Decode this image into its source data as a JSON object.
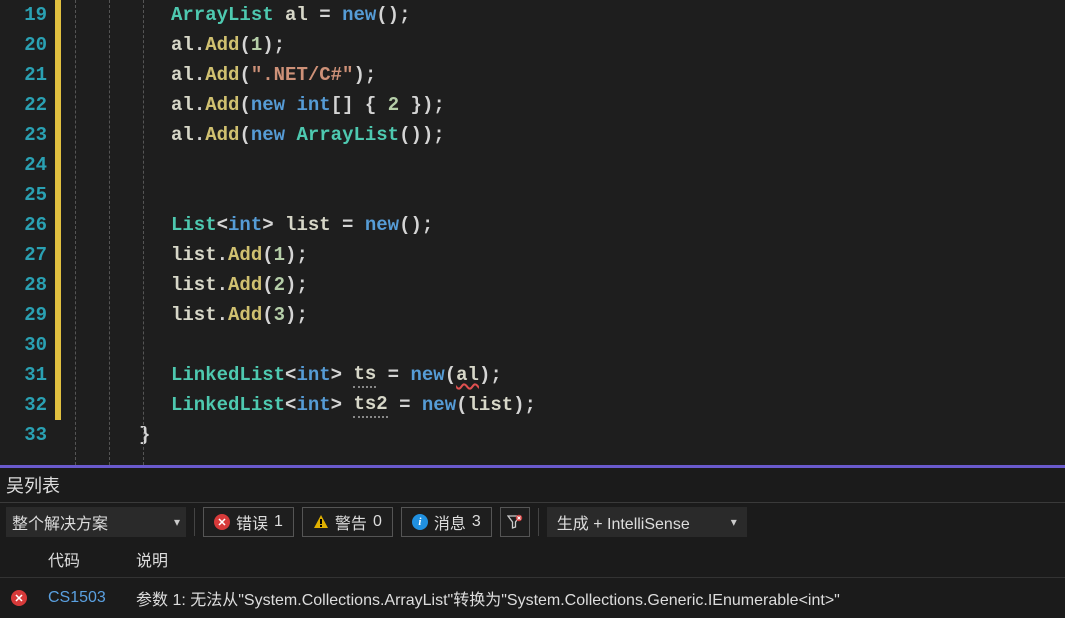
{
  "lines": [
    {
      "n": 19,
      "mod": true
    },
    {
      "n": 20,
      "mod": true
    },
    {
      "n": 21,
      "mod": true
    },
    {
      "n": 22,
      "mod": true
    },
    {
      "n": 23,
      "mod": true
    },
    {
      "n": 24,
      "mod": true
    },
    {
      "n": 25,
      "mod": true
    },
    {
      "n": 26,
      "mod": true
    },
    {
      "n": 27,
      "mod": true
    },
    {
      "n": 28,
      "mod": true
    },
    {
      "n": 29,
      "mod": true
    },
    {
      "n": 30,
      "mod": true
    },
    {
      "n": 31,
      "mod": true
    },
    {
      "n": 32,
      "mod": true
    },
    {
      "n": 33,
      "mod": false
    }
  ],
  "code": {
    "l18_brace": "{",
    "l19": {
      "type": "ArrayList",
      "var": "al",
      "eq": "=",
      "kw": "new",
      "rest": "();"
    },
    "l20": {
      "var": "al",
      "dot": ".",
      "mth": "Add",
      "open": "(",
      "arg": "1",
      "close": ");"
    },
    "l21": {
      "var": "al",
      "dot": ".",
      "mth": "Add",
      "open": "(",
      "arg": "\".NET/C#\"",
      "close": ");"
    },
    "l22": {
      "var": "al",
      "dot": ".",
      "mth": "Add",
      "open": "(",
      "kw": "new",
      "sp": " ",
      "type": "int",
      "arr": "[]",
      "br": " { ",
      "num": "2",
      "brc": " }",
      "close": ");"
    },
    "l23": {
      "var": "al",
      "dot": ".",
      "mth": "Add",
      "open": "(",
      "kw": "new",
      "sp": " ",
      "type": "ArrayList",
      "paren": "()",
      "close": ");"
    },
    "l26": {
      "type": "List",
      "lt": "<",
      "gen": "int",
      "gt": ">",
      "sp": " ",
      "var": "list",
      "eq": " = ",
      "kw": "new",
      "rest": "();"
    },
    "l27": {
      "var": "list",
      "dot": ".",
      "mth": "Add",
      "open": "(",
      "arg": "1",
      "close": ");"
    },
    "l28": {
      "var": "list",
      "dot": ".",
      "mth": "Add",
      "open": "(",
      "arg": "2",
      "close": ");"
    },
    "l29": {
      "var": "list",
      "dot": ".",
      "mth": "Add",
      "open": "(",
      "arg": "3",
      "close": ");"
    },
    "l31": {
      "type": "LinkedList",
      "lt": "<",
      "gen": "int",
      "gt": ">",
      "sp": " ",
      "var": "ts",
      "eq": " = ",
      "kw": "new",
      "open": "(",
      "arg": "al",
      "close": ");"
    },
    "l32": {
      "type": "LinkedList",
      "lt": "<",
      "gen": "int",
      "gt": ">",
      "sp": " ",
      "var": "ts2",
      "eq": " = ",
      "kw": "new",
      "open": "(",
      "arg": "list",
      "close": ");"
    },
    "l33_brace": "}"
  },
  "errlist": {
    "title": "吴列表",
    "scope": "整个解决方案",
    "errors_label": "错误",
    "errors_count": "1",
    "warnings_label": "警告",
    "warnings_count": "0",
    "messages_label": "消息",
    "messages_count": "3",
    "build_intellisense": "生成 + IntelliSense",
    "col_code": "代码",
    "col_desc": "说明",
    "row1": {
      "code": "CS1503",
      "desc": "参数 1: 无法从\"System.Collections.ArrayList\"转换为\"System.Collections.Generic.IEnumerable<int>\""
    }
  }
}
